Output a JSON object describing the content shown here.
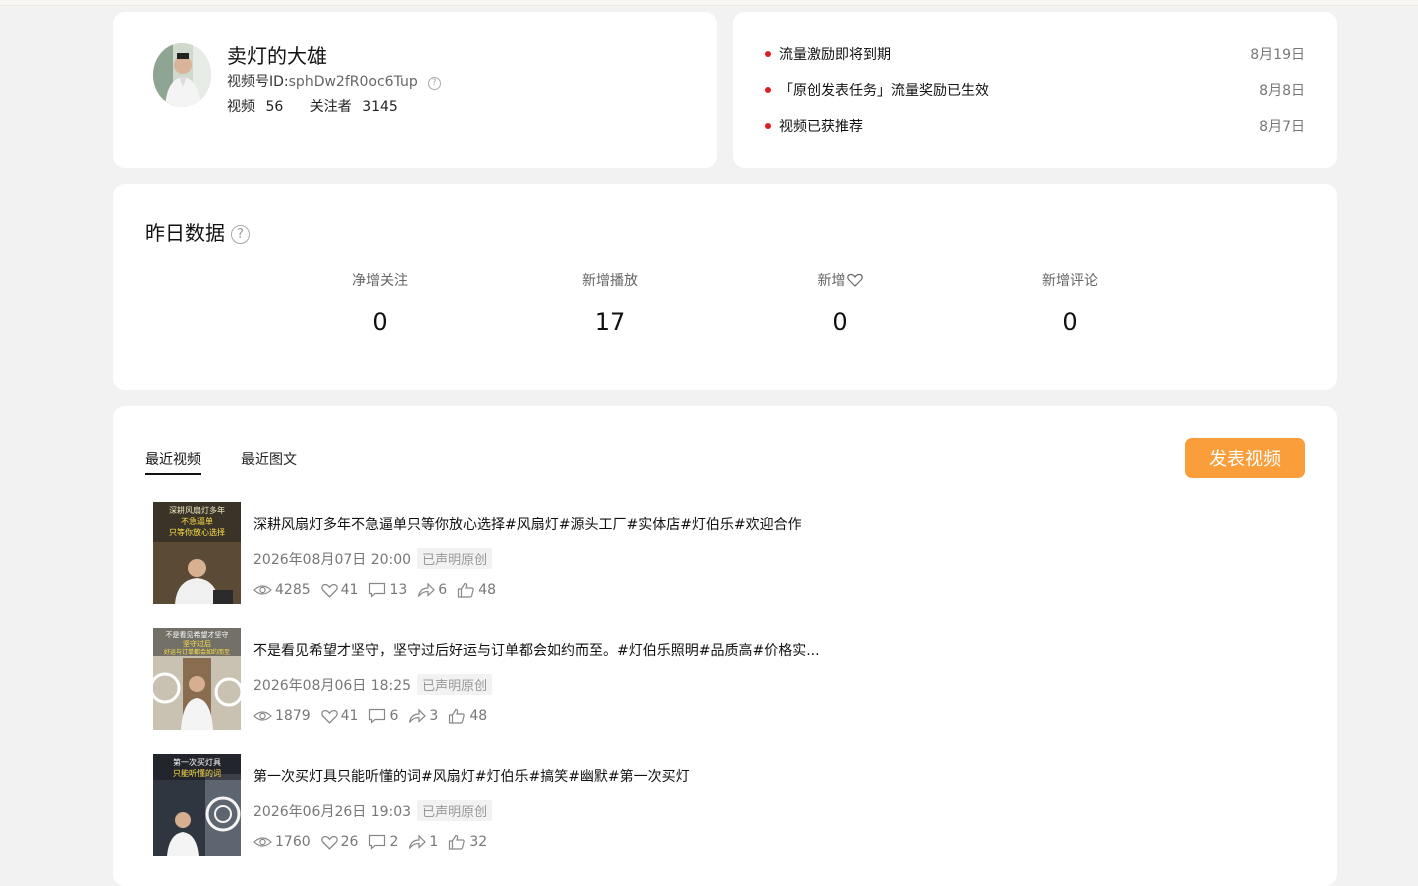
{
  "profile": {
    "name": "卖灯的大雄",
    "id_label": "视频号ID:",
    "id_value": "sphDw2fR0oc6Tup",
    "help_glyph": "?",
    "videos_label": "视频",
    "videos_count": "56",
    "followers_label": "关注者",
    "followers_count": "3145"
  },
  "notices": [
    {
      "text": "流量激励即将到期",
      "date": "8月19日"
    },
    {
      "text": "「原创发表任务」流量奖励已生效",
      "date": "8月8日"
    },
    {
      "text": "视频已获推荐",
      "date": "8月7日"
    }
  ],
  "yesterday": {
    "title": "昨日数据",
    "help_glyph": "?",
    "stats": [
      {
        "label": "净增关注",
        "value": "0"
      },
      {
        "label": "新增播放",
        "value": "17"
      },
      {
        "label": "新增",
        "value": "0",
        "icon": "heart-icon"
      },
      {
        "label": "新增评论",
        "value": "0"
      }
    ]
  },
  "recent": {
    "tabs": [
      {
        "label": "最近视频",
        "active": true
      },
      {
        "label": "最近图文",
        "active": false
      }
    ],
    "publish_label": "发表视频",
    "accent_color": "#fa9d3b",
    "videos": [
      {
        "title": "深耕风扇灯多年不急逼单只等你放心选择#风扇灯#源头工厂#实体店#灯伯乐#欢迎合作",
        "datetime": "2026年08月07日 20:00",
        "tag": "已声明原创",
        "thumb_caption": "深耕风扇灯多年",
        "thumb_caption2": "不急逼单",
        "thumb_caption3": "只等你放心选择",
        "views": "4285",
        "likes": "41",
        "comments": "13",
        "shares": "6",
        "thumbs": "48"
      },
      {
        "title": "不是看见希望才坚守，坚守过后好运与订单都会如约而至。#灯伯乐照明#品质高#价格实...",
        "datetime": "2026年08月06日 18:25",
        "tag": "已声明原创",
        "thumb_caption": "不是看见希望才坚守",
        "thumb_caption2": "坚守过后",
        "thumb_caption3": "好运与订单都会如约而至",
        "views": "1879",
        "likes": "41",
        "comments": "6",
        "shares": "3",
        "thumbs": "48"
      },
      {
        "title": "第一次买灯具只能听懂的词#风扇灯#灯伯乐#搞笑#幽默#第一次买灯",
        "datetime": "2026年06月26日 19:03",
        "tag": "已声明原创",
        "thumb_caption": "第一次买灯具",
        "thumb_caption2": "只能听懂的词",
        "thumb_caption3": "",
        "views": "1760",
        "likes": "26",
        "comments": "2",
        "shares": "1",
        "thumbs": "32"
      }
    ]
  }
}
